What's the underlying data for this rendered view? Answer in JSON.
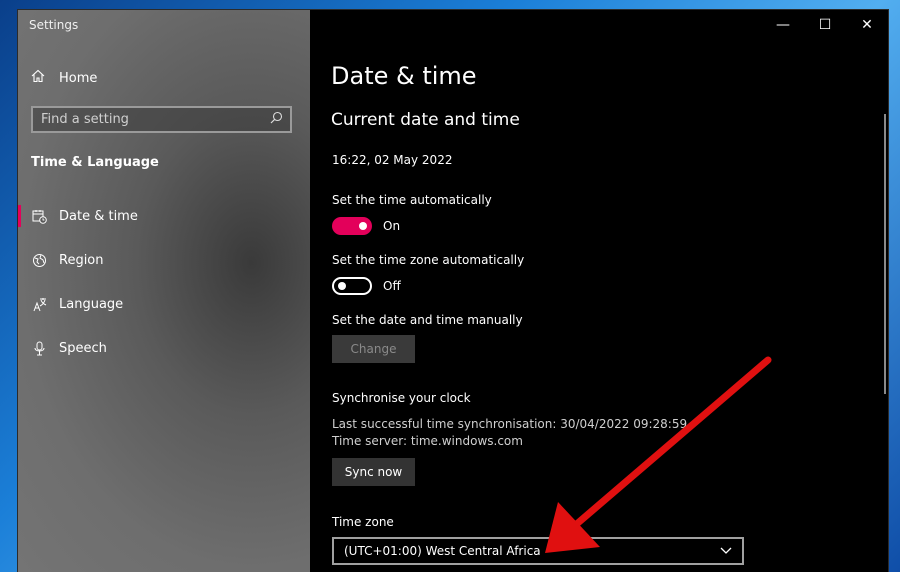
{
  "window": {
    "title": "Settings",
    "controls": {
      "minimize": "—",
      "maximize": "☐",
      "close": "✕"
    }
  },
  "sidebar": {
    "home_label": "Home",
    "search_placeholder": "Find a setting",
    "section_heading": "Time & Language",
    "items": [
      {
        "label": "Date & time",
        "icon": "calendar-clock-icon",
        "active": true
      },
      {
        "label": "Region",
        "icon": "globe-icon",
        "active": false
      },
      {
        "label": "Language",
        "icon": "language-icon",
        "active": false
      },
      {
        "label": "Speech",
        "icon": "microphone-icon",
        "active": false
      }
    ]
  },
  "main": {
    "page_title": "Date & time",
    "current_heading": "Current date and time",
    "current_value": "16:22, 02 May 2022",
    "auto_time": {
      "label": "Set the time automatically",
      "state": "On"
    },
    "auto_zone": {
      "label": "Set the time zone automatically",
      "state": "Off"
    },
    "manual": {
      "label": "Set the date and time manually",
      "button": "Change"
    },
    "sync": {
      "heading": "Synchronise your clock",
      "last_sync": "Last successful time synchronisation: 30/04/2022 09:28:59",
      "server": "Time server: time.windows.com",
      "button": "Sync now"
    },
    "timezone": {
      "label": "Time zone",
      "value": "(UTC+01:00) West Central Africa"
    }
  },
  "colors": {
    "accent": "#e3005a",
    "annotation_arrow": "#e01010"
  }
}
